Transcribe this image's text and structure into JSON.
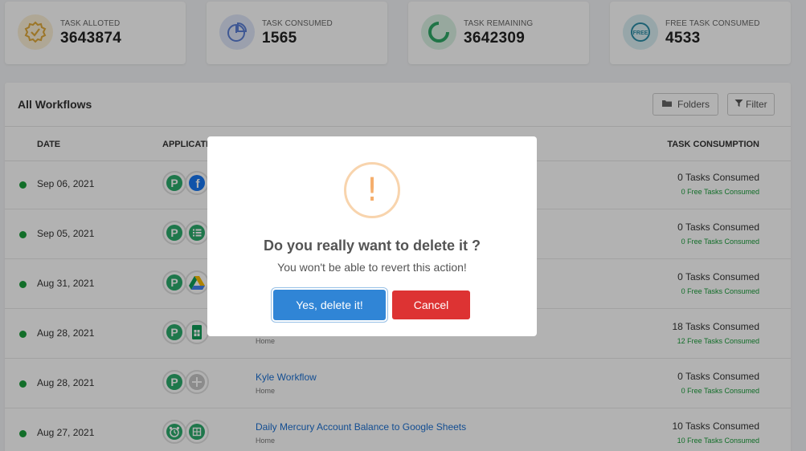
{
  "stats": [
    {
      "label": "TASK ALLOTED",
      "value": "3643874",
      "icon": "badge-check-icon",
      "color": "#f4c56a"
    },
    {
      "label": "TASK CONSUMED",
      "value": "1565",
      "icon": "pie-chart-icon",
      "color": "#8aa6e8"
    },
    {
      "label": "TASK REMAINING",
      "value": "3642309",
      "icon": "progress-ring-icon",
      "color": "#7fcfa2"
    },
    {
      "label": "FREE TASK CONSUMED",
      "value": "4533",
      "icon": "free-badge-icon",
      "color": "#7fc7d8"
    }
  ],
  "panel": {
    "title": "All Workflows",
    "folders_label": "Folders",
    "filter_label": "Filter"
  },
  "table": {
    "headers": {
      "date": "DATE",
      "applications": "APPLICATI",
      "consumption": "TASK CONSUMPTION"
    },
    "rows": [
      {
        "date": "Sep 06, 2021",
        "name": "",
        "folder": "",
        "tasks": "0 Tasks Consumed",
        "free": "0 Free Tasks Consumed",
        "apps": [
          "pabbly-icon",
          "facebook-icon"
        ]
      },
      {
        "date": "Sep 05, 2021",
        "name": "",
        "folder": "",
        "tasks": "0 Tasks Consumed",
        "free": "0 Free Tasks Consumed",
        "apps": [
          "pabbly-icon",
          "list-icon"
        ]
      },
      {
        "date": "Aug 31, 2021",
        "name": "",
        "folder": "",
        "tasks": "0 Tasks Consumed",
        "free": "0 Free Tasks Consumed",
        "apps": [
          "pabbly-icon",
          "google-drive-icon"
        ]
      },
      {
        "date": "Aug 28, 2021",
        "name": "",
        "folder": "Home",
        "tasks": "18 Tasks Consumed",
        "free": "12 Free Tasks Consumed",
        "apps": [
          "pabbly-icon",
          "google-sheets-icon"
        ]
      },
      {
        "date": "Aug 28, 2021",
        "name": "Kyle Workflow",
        "folder": "Home",
        "tasks": "0 Tasks Consumed",
        "free": "0 Free Tasks Consumed",
        "apps": [
          "pabbly-icon",
          "add-icon"
        ]
      },
      {
        "date": "Aug 27, 2021",
        "name": "Daily Mercury Account Balance to Google Sheets",
        "folder": "Home",
        "tasks": "10 Tasks Consumed",
        "free": "10 Free Tasks Consumed",
        "apps": [
          "alarm-icon",
          "google-sheets-icon"
        ]
      }
    ]
  },
  "modal": {
    "icon": "!",
    "title": "Do you really want to delete it ?",
    "text": "You won't be able to revert this action!",
    "confirm_label": "Yes, delete it!",
    "cancel_label": "Cancel"
  }
}
